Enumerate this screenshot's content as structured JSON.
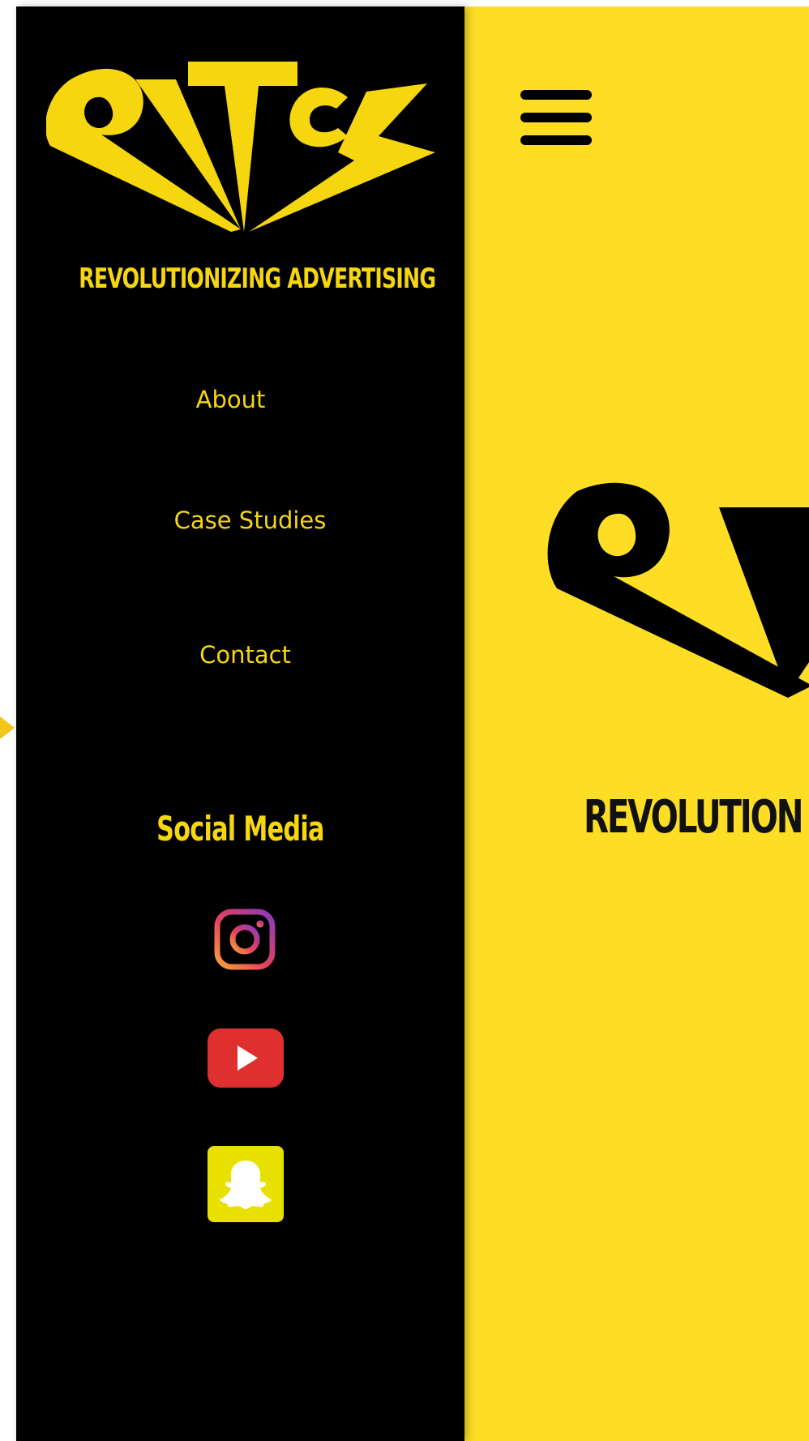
{
  "colors": {
    "sidebar_bg": "#000000",
    "main_bg": "#fdde25",
    "accent_yellow": "#f5d60f",
    "text_dark": "#111111"
  },
  "sidebar": {
    "logo_icon": "pitch-logo-icon",
    "tagline": "REVOLUTIONIZING ADVERTISING",
    "nav": {
      "about": "About",
      "case_studies": "Case Studies",
      "contact": "Contact"
    },
    "social_heading": "Social Media",
    "social_icons": [
      "instagram-icon",
      "youtube-icon",
      "snapchat-icon"
    ]
  },
  "main": {
    "menu_icon": "hamburger-menu-icon",
    "logo_icon": "pitch-logo-icon",
    "tagline": "REVOLUTION"
  }
}
